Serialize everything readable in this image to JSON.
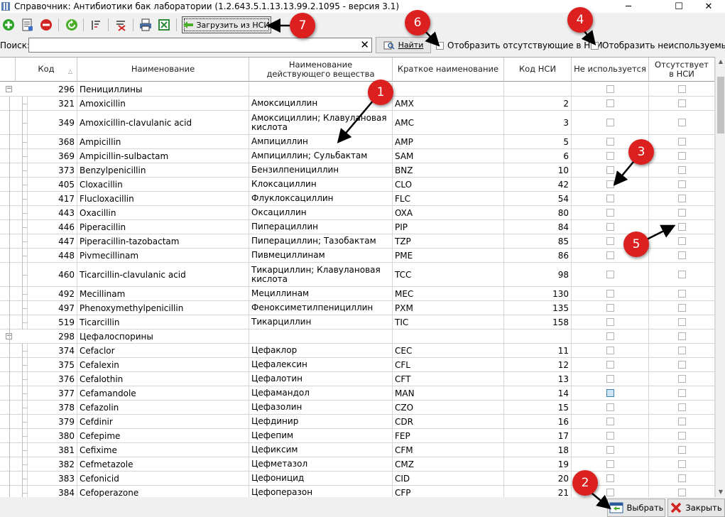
{
  "window": {
    "title": "Справочник: Антибиотики бак лаборатории (1.2.643.5.1.13.13.99.2.1095 - версия 3.1)",
    "minimize": "─",
    "maximize": "☐",
    "close": "✕"
  },
  "toolbar": {
    "load_nsi_label": "Загрузить из НСИ",
    "icons": [
      "add-icon",
      "properties-icon",
      "delete-icon",
      "refresh-icon",
      "filter-icon",
      "clear-filter-icon",
      "print-icon",
      "excel-icon"
    ]
  },
  "search": {
    "label": "Поиск:",
    "value": "",
    "clear": "✕",
    "find_label": "Найти",
    "show_missing_label": "Отобразить отсутствующие в НСИ",
    "show_unused_label": "Отобразить неиспользуемые"
  },
  "table": {
    "columns": [
      "Код",
      "Наименование",
      "Наименование действующего вещества",
      "Краткое наименование",
      "Код НСИ",
      "Не используется",
      "Отсутствует в НСИ"
    ],
    "rows": [
      {
        "group": true,
        "code": "296",
        "name": "Пенициллины",
        "substance": "",
        "short": "",
        "nsi": "",
        "unused": false
      },
      {
        "code": "321",
        "name": "Amoxicillin",
        "substance": "Амоксициллин",
        "short": "AMX",
        "nsi": "2",
        "unused": false
      },
      {
        "code": "349",
        "name": "Amoxicillin-clavulanic acid",
        "substance": "Амоксициллин; Клавулановая кислота",
        "short": "AMC",
        "nsi": "3",
        "unused": false,
        "tall": true
      },
      {
        "code": "368",
        "name": "Ampicillin",
        "substance": "Ампициллин",
        "short": "AMP",
        "nsi": "5",
        "unused": false
      },
      {
        "code": "369",
        "name": "Ampicillin-sulbactam",
        "substance": "Ампициллин; Сульбактам",
        "short": "SAM",
        "nsi": "6",
        "unused": false
      },
      {
        "code": "373",
        "name": "Benzylpenicillin",
        "substance": "Бензилпенициллин",
        "short": "BNZ",
        "nsi": "10",
        "unused": false
      },
      {
        "code": "405",
        "name": "Cloxacillin",
        "substance": "Клоксациллин",
        "short": "CLO",
        "nsi": "42",
        "unused": false
      },
      {
        "code": "417",
        "name": "Flucloxacillin",
        "substance": "Флуклоксациллин",
        "short": "FLC",
        "nsi": "54",
        "unused": false
      },
      {
        "code": "443",
        "name": "Oxacillin",
        "substance": "Оксациллин",
        "short": "OXA",
        "nsi": "80",
        "unused": false
      },
      {
        "code": "446",
        "name": "Piperacillin",
        "substance": "Пиперациллин",
        "short": "PIP",
        "nsi": "84",
        "unused": false
      },
      {
        "code": "447",
        "name": "Piperacillin-tazobactam",
        "substance": "Пиперациллин; Тазобактам",
        "short": "TZP",
        "nsi": "85",
        "unused": false
      },
      {
        "code": "448",
        "name": "Pivmecillinam",
        "substance": "Пивмециллинам",
        "short": "PME",
        "nsi": "86",
        "unused": false
      },
      {
        "code": "460",
        "name": "Ticarcillin-clavulanic acid",
        "substance": "Тикарциллин; Клавулановая кислота",
        "short": "TCC",
        "nsi": "98",
        "unused": false,
        "tall": true
      },
      {
        "code": "492",
        "name": "Mecillinam",
        "substance": "Мециллинам",
        "short": "MEC",
        "nsi": "130",
        "unused": false
      },
      {
        "code": "497",
        "name": "Phenoxymethylpenicillin",
        "substance": "Феноксиметилпенициллин",
        "short": "PXM",
        "nsi": "135",
        "unused": false
      },
      {
        "code": "519",
        "name": "Ticarcillin",
        "substance": "Тикарциллин",
        "short": "TIC",
        "nsi": "158",
        "unused": false
      },
      {
        "group": true,
        "code": "298",
        "name": "Цефалоспорины",
        "substance": "",
        "short": "",
        "nsi": "",
        "unused": false
      },
      {
        "code": "374",
        "name": "Cefaclor",
        "substance": "Цефаклор",
        "short": "CEC",
        "nsi": "11",
        "unused": false
      },
      {
        "code": "375",
        "name": "Cefalexin",
        "substance": "Цефалексин",
        "short": "CFL",
        "nsi": "12",
        "unused": false
      },
      {
        "code": "376",
        "name": "Cefalothin",
        "substance": "Цефалотин",
        "short": "CFT",
        "nsi": "13",
        "unused": false
      },
      {
        "code": "377",
        "name": "Cefamandole",
        "substance": "Цефамандол",
        "short": "MAN",
        "nsi": "14",
        "unused": true
      },
      {
        "code": "378",
        "name": "Cefazolin",
        "substance": "Цефазолин",
        "short": "CZO",
        "nsi": "15",
        "unused": false
      },
      {
        "code": "379",
        "name": "Cefdinir",
        "substance": "Цефдинир",
        "short": "CDR",
        "nsi": "16",
        "unused": false
      },
      {
        "code": "380",
        "name": "Cefepime",
        "substance": "Цефепим",
        "short": "FEP",
        "nsi": "17",
        "unused": false
      },
      {
        "code": "381",
        "name": "Cefixime",
        "substance": "Цефиксим",
        "short": "CFM",
        "nsi": "18",
        "unused": false
      },
      {
        "code": "382",
        "name": "Cefmetazole",
        "substance": "Цефметазол",
        "short": "CMZ",
        "nsi": "19",
        "unused": false
      },
      {
        "code": "383",
        "name": "Cefonicid",
        "substance": "Цефоницид",
        "short": "CID",
        "nsi": "20",
        "unused": false
      },
      {
        "code": "384",
        "name": "Cefoperazone",
        "substance": "Цефоперазон",
        "short": "CFP",
        "nsi": "21",
        "unused": false
      }
    ]
  },
  "buttons": {
    "select_label": "Выбрать",
    "close_label": "Закрыть"
  },
  "callouts": [
    "1",
    "2",
    "3",
    "4",
    "5",
    "6",
    "7"
  ],
  "colors": {
    "callout": "#dc1f1f",
    "add": "#2aa52a",
    "delete": "#d12424",
    "excel": "#2e8b3a",
    "highlight_checkbox": "#cde4f7"
  }
}
